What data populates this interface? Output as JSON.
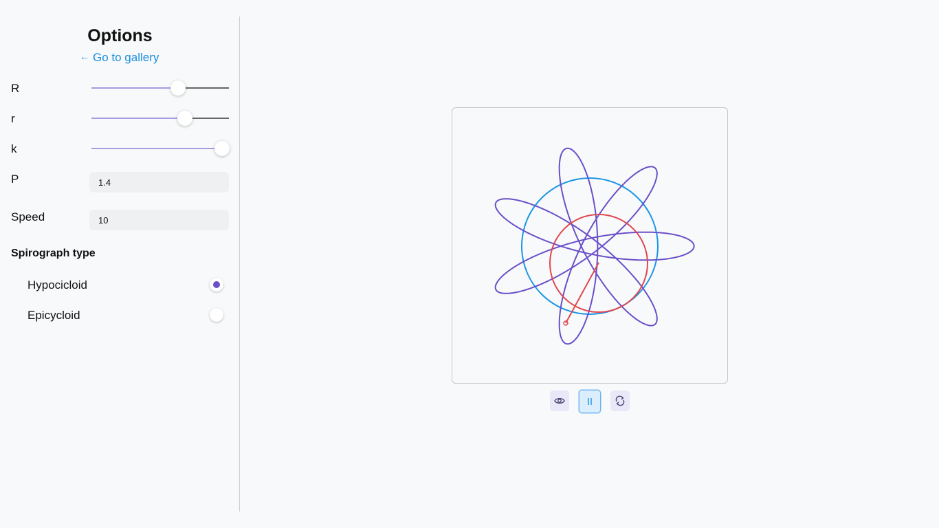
{
  "sidebar": {
    "title": "Options",
    "gallery_link": {
      "arrow": "←",
      "label": "Go to gallery"
    },
    "sliders": [
      {
        "label": "R",
        "value": 0.63
      },
      {
        "label": "r",
        "value": 0.68
      },
      {
        "label": "k",
        "value": 0.95
      }
    ],
    "inputs": [
      {
        "label": "P",
        "value": "1.4"
      },
      {
        "label": "Speed",
        "value": "10"
      }
    ],
    "type_section": {
      "title": "Spirograph type",
      "options": [
        {
          "label": "Hypocicloid",
          "selected": true
        },
        {
          "label": "Epicycloid",
          "selected": false
        }
      ]
    }
  },
  "controls": {
    "visibility_icon": "eye-icon",
    "pause_icon": "pause-icon",
    "reset_icon": "refresh-icon"
  },
  "colors": {
    "accent": "#6a4fc8",
    "link": "#1c8fe0",
    "outer_circle": "#1a96e6",
    "inner_circle": "#e0474f",
    "curve": "#6a4fc8"
  }
}
